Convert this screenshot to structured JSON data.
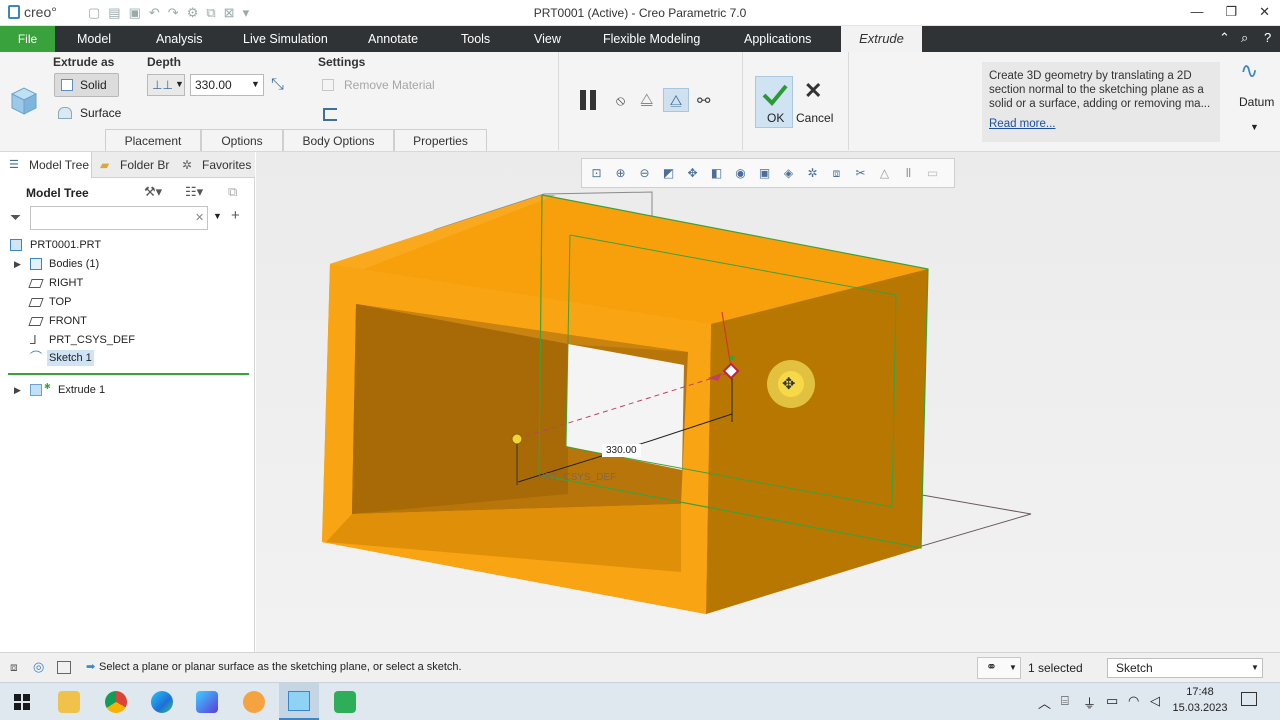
{
  "titlebar": {
    "app_logo": "creo°",
    "window_title": "PRT0001 (Active) - Creo Parametric 7.0",
    "minimize": "—",
    "restore": "❐",
    "close": "✕"
  },
  "menubar": {
    "file": "File",
    "tabs": [
      "Model",
      "Analysis",
      "Live Simulation",
      "Annotate",
      "Tools",
      "View",
      "Flexible Modeling",
      "Applications"
    ],
    "active_tab": "Extrude"
  },
  "ribbon": {
    "extrude_as_label": "Extrude as",
    "solid_label": "Solid",
    "surface_label": "Surface",
    "depth_label": "Depth",
    "depth_value": "330.00",
    "settings_label": "Settings",
    "remove_material_label": "Remove Material",
    "ok_label": "OK",
    "cancel_label": "Cancel",
    "datum_label": "Datum",
    "subtabs": [
      "Placement",
      "Options",
      "Body Options",
      "Properties"
    ],
    "help_text": "Create 3D geometry by translating a 2D section normal to the sketching plane as a solid or a surface, adding or removing ma...",
    "read_more": "Read more..."
  },
  "leftpanel": {
    "tabs": [
      "Model Tree",
      "Folder Br",
      "Favorites"
    ],
    "header": "Model Tree",
    "search_placeholder": "",
    "items": [
      {
        "label": "PRT0001.PRT",
        "icon": "part-icon"
      },
      {
        "label": "Bodies (1)",
        "icon": "bodies-icon"
      },
      {
        "label": "RIGHT",
        "icon": "datum-plane-icon"
      },
      {
        "label": "TOP",
        "icon": "datum-plane-icon"
      },
      {
        "label": "FRONT",
        "icon": "datum-plane-icon"
      },
      {
        "label": "PRT_CSYS_DEF",
        "icon": "csys-icon"
      },
      {
        "label": "Sketch 1",
        "icon": "sketch-icon"
      },
      {
        "label": "Extrude 1",
        "icon": "extrude-icon"
      }
    ]
  },
  "graphics": {
    "dimension_label": "330.00",
    "csys_label": "PRT_CSYS_DEF",
    "model_color": "#f8a00c"
  },
  "statusbar": {
    "message": "Select a plane or planar surface as the sketching plane, or select a sketch.",
    "selected": "1 selected",
    "filter": "Sketch"
  },
  "taskbar": {
    "time": "17:48",
    "date": "15.03.2023"
  }
}
